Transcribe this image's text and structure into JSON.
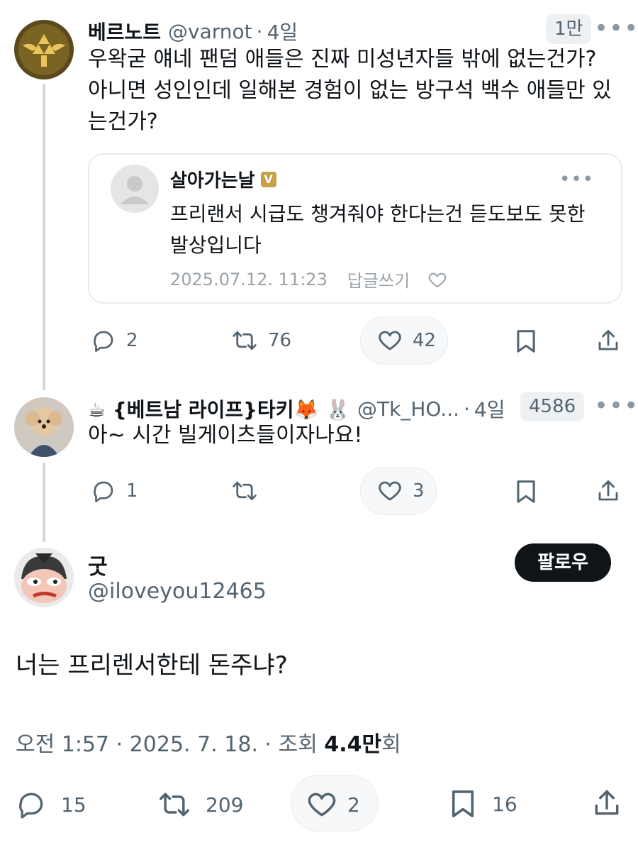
{
  "tweet1": {
    "name": "베르노트",
    "handle": "@varnot",
    "time": "4일",
    "badge": "1만",
    "text": "우왁굳 얘네 팬덤 애들은 진짜 미성년자들 밖에 없는건가? 아니면 성인인데 일해본 경험이 없는 방구석 백수 애들만 있는건가?",
    "quote": {
      "name": "살아가는날",
      "verified_mark": "V",
      "text": "프리랜서 시급도 챙겨줘야 한다는건 듣도보도 못한 발상입니다",
      "datetime": "2025.07.12. 11:23",
      "reply_label": "답글쓰기"
    },
    "replies": "2",
    "retweets": "76",
    "likes": "42"
  },
  "tweet2": {
    "name_prefix": "☕ {베트남 라이프}타키🦊 🐰",
    "handle": "@Tk_HO...",
    "time": "4일",
    "badge": "4586",
    "text": "아~ 시간 빌게이츠들이자나요!",
    "replies": "1",
    "retweets": "",
    "likes": "3"
  },
  "main": {
    "name": "굿",
    "handle": "@iloveyou12465",
    "follow_label": "팔로우",
    "text": "너는 프리렌서한테 돈주냐?",
    "meta_prefix": "오전 1:57 · 2025. 7. 18. · 조회 ",
    "views": "4.4만",
    "views_suffix": "회",
    "replies": "15",
    "retweets": "209",
    "likes": "2",
    "bookmarks": "16"
  },
  "icons": {
    "more": "more-horizontal-icon",
    "reply": "reply-bubble-icon",
    "retweet": "retweet-icon",
    "like": "heart-icon",
    "bookmark": "bookmark-icon",
    "share": "share-upload-icon"
  },
  "colors": {
    "text": "#0f1419",
    "secondary": "#536471",
    "follow_bg": "#0f1419",
    "verified": "#c6a14a"
  }
}
